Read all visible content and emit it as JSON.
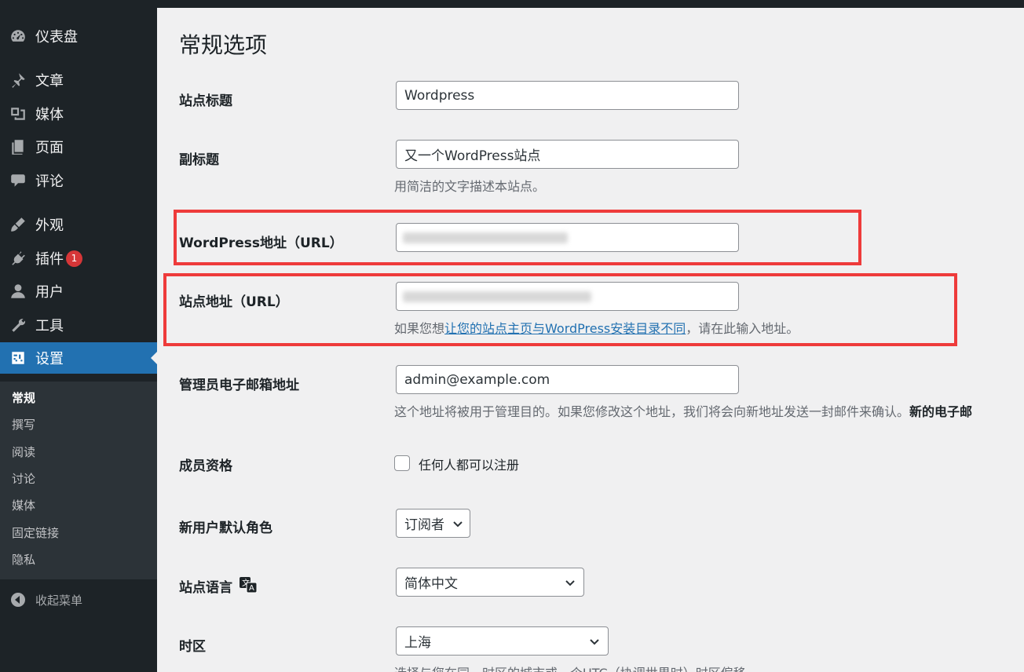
{
  "sidebar": {
    "items": [
      {
        "label": "仪表盘",
        "icon": "dashboard-icon"
      },
      {
        "label": "文章",
        "icon": "pin-icon"
      },
      {
        "label": "媒体",
        "icon": "media-icon"
      },
      {
        "label": "页面",
        "icon": "page-icon"
      },
      {
        "label": "评论",
        "icon": "comment-icon"
      },
      {
        "label": "外观",
        "icon": "appearance-icon"
      },
      {
        "label": "插件",
        "icon": "plugin-icon",
        "badge": "1"
      },
      {
        "label": "用户",
        "icon": "user-icon"
      },
      {
        "label": "工具",
        "icon": "wrench-icon"
      },
      {
        "label": "设置",
        "icon": "settings-icon"
      }
    ],
    "submenu": [
      "常规",
      "撰写",
      "阅读",
      "讨论",
      "媒体",
      "固定链接",
      "隐私"
    ],
    "collapse_label": "收起菜单"
  },
  "page": {
    "title": "常规选项",
    "site_title": {
      "label": "站点标题",
      "value": "Wordpress"
    },
    "tagline": {
      "label": "副标题",
      "value": "又一个WordPress站点",
      "description": "用简洁的文字描述本站点。"
    },
    "wp_address": {
      "label": "WordPress地址（URL）"
    },
    "site_address": {
      "label": "站点地址（URL）",
      "desc_before": "如果您想",
      "desc_link": "让您的站点主页与WordPress安装目录不同",
      "desc_after": "，请在此输入地址。"
    },
    "admin_email": {
      "label": "管理员电子邮箱地址",
      "value": "admin@example.com",
      "description": "这个地址将被用于管理目的。如果您修改这个地址，我们将会向新地址发送一封邮件来确认。",
      "description_bold": "新的电子邮"
    },
    "membership": {
      "label": "成员资格",
      "checkbox_label": "任何人都可以注册",
      "checked": false
    },
    "default_role": {
      "label": "新用户默认角色",
      "value": "订阅者"
    },
    "site_language": {
      "label": "站点语言",
      "value": "简体中文"
    },
    "timezone": {
      "label": "时区",
      "value": "上海",
      "description": "选择与您在同一时区的城市或一个UTC（协调世界时）时区偏移。"
    }
  },
  "colors": {
    "accent": "#2271b1",
    "sidebar_bg": "#1d2327",
    "highlight_box": "#ee3b3b",
    "badge": "#d63638"
  }
}
